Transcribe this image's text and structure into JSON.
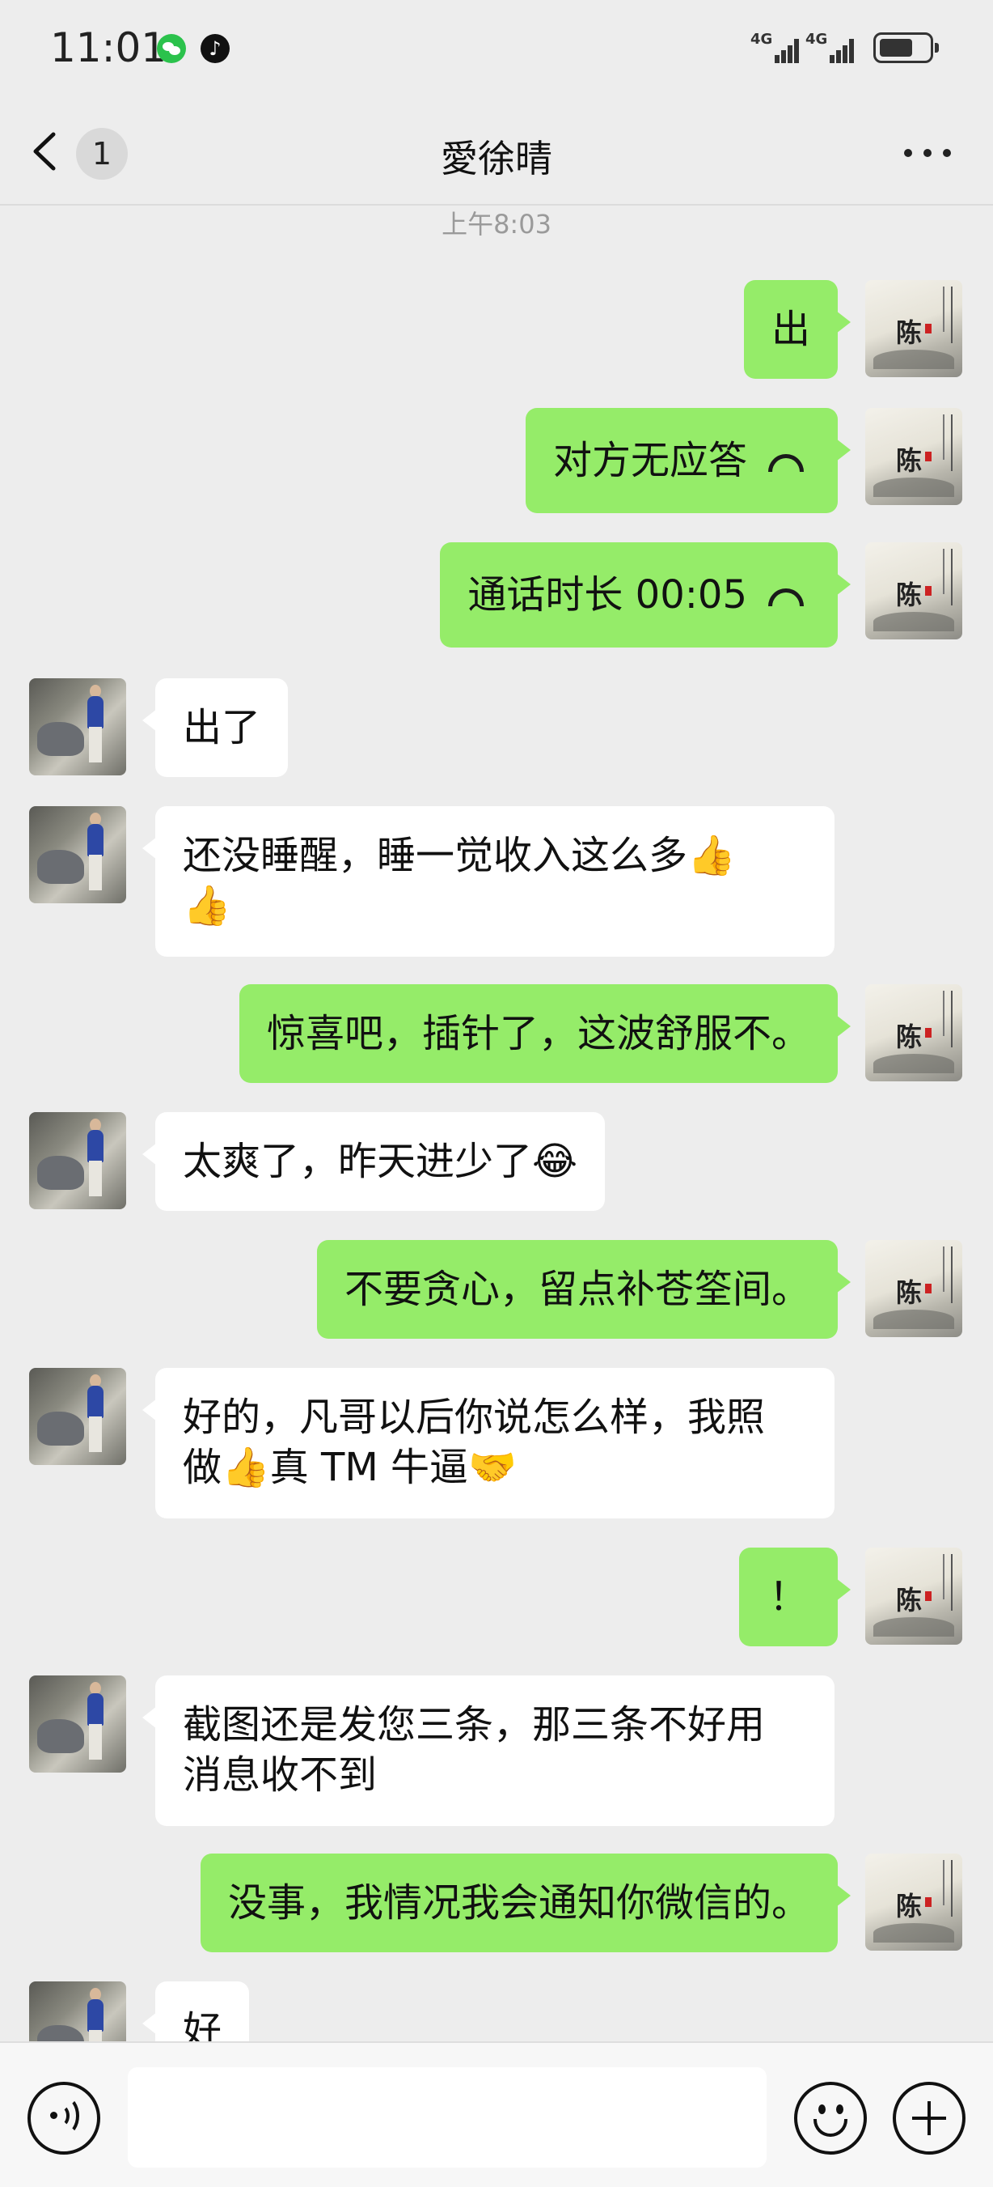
{
  "status_bar": {
    "time": "11:01",
    "signal1": "4G",
    "signal2": "4G"
  },
  "nav": {
    "back_count": "1",
    "title": "愛徐晴"
  },
  "timestamp": "上午8:03",
  "messages": [
    {
      "from": "me",
      "text": "出"
    },
    {
      "from": "me",
      "text": "对方无应答",
      "icon": "phone-hangup-icon"
    },
    {
      "from": "me",
      "text": "通话时长 00:05",
      "icon": "phone-hangup-icon"
    },
    {
      "from": "other",
      "text": "出了"
    },
    {
      "from": "other",
      "text": "还没睡醒，睡一觉收入这么多👍",
      "text2": "👍"
    },
    {
      "from": "me",
      "text": "惊喜吧，插针了，这波舒服不。"
    },
    {
      "from": "other",
      "text": "太爽了，昨天进少了😂"
    },
    {
      "from": "me",
      "text": "不要贪心，留点补苍筌间。"
    },
    {
      "from": "other",
      "text": "好的，凡哥以后你说怎么样，我照",
      "text2": "做👍真 TM 牛逼🤝"
    },
    {
      "from": "me",
      "text": "！"
    },
    {
      "from": "other",
      "text": "截图还是发您三条，那三条不好用",
      "text2": "消息收不到"
    },
    {
      "from": "me",
      "text": "没事，我情况我会通知你微信的。"
    },
    {
      "from": "other",
      "text": "好"
    }
  ],
  "me_avatar_seal": "陈",
  "icons": {
    "back": "chevron-left-icon",
    "more": "more-dots-icon",
    "voice": "voice-icon",
    "emoji": "emoji-icon",
    "plus": "plus-icon"
  },
  "colors": {
    "me_bubble": "#95ec69",
    "other_bubble": "#ffffff",
    "background": "#ededed"
  }
}
